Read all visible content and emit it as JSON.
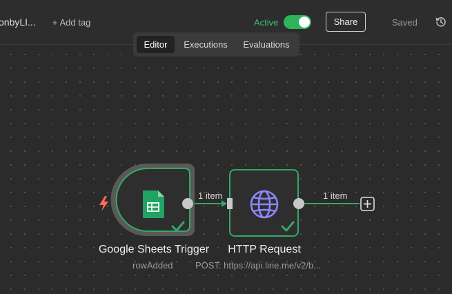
{
  "header": {
    "workflow_name": "onbyLI...",
    "add_tag": "+ Add tag",
    "active_label": "Active",
    "active": true,
    "share_label": "Share",
    "saved_label": "Saved"
  },
  "tabs": [
    {
      "label": "Editor",
      "selected": true
    },
    {
      "label": "Executions",
      "selected": false
    },
    {
      "label": "Evaluations",
      "selected": false
    }
  ],
  "nodes": [
    {
      "name": "Google Sheets Trigger",
      "subtitle": "rowAdded",
      "icon": "google-sheets-icon",
      "status": "success"
    },
    {
      "name": "HTTP Request",
      "subtitle": "POST: https://api.line.me/v2/b...",
      "icon": "globe-icon",
      "status": "success"
    }
  ],
  "connections": [
    {
      "label": "1 item"
    },
    {
      "label": "1 item"
    }
  ],
  "colors": {
    "accent_green": "#2fb45c",
    "node_border": "#36a867",
    "trigger_icon": "#ff6d5a",
    "globe_icon": "#8d86ff"
  }
}
